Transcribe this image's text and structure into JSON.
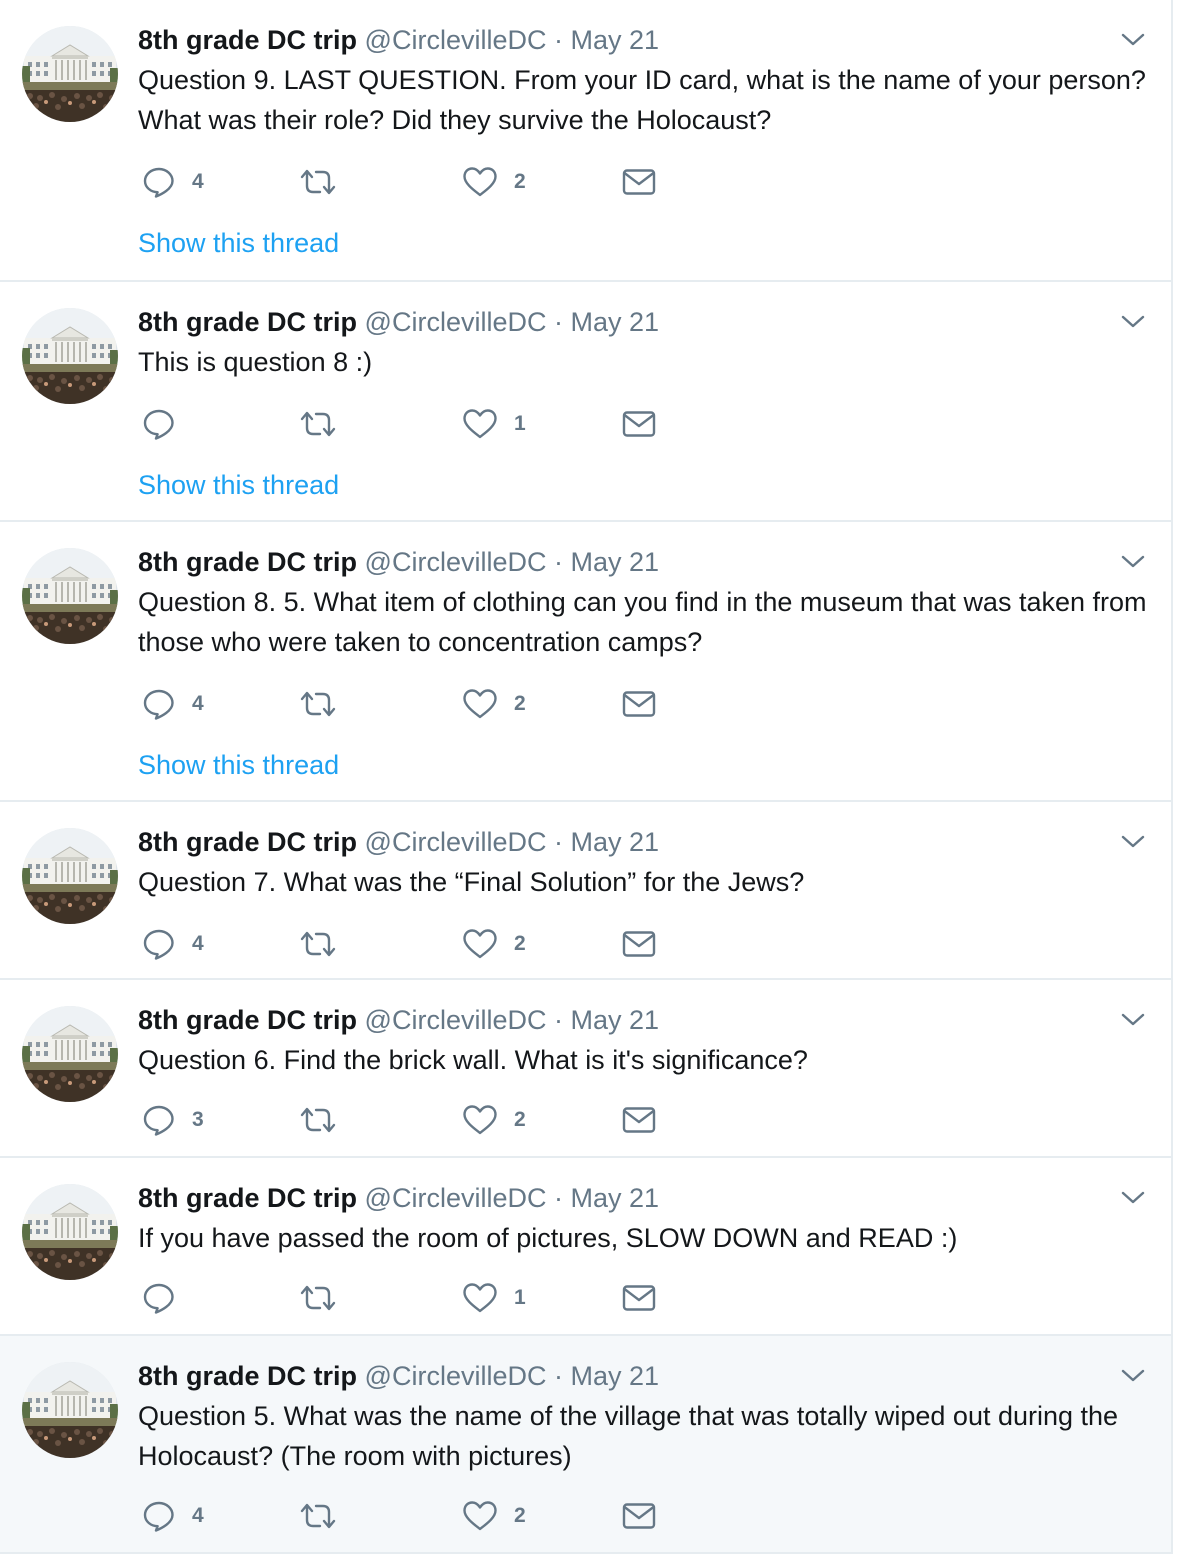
{
  "colors": {
    "link": "#1da1f2",
    "muted": "#657786",
    "text": "#14171a",
    "border": "#e6ecf0",
    "highlight": "#f5f8fa"
  },
  "icons": {
    "reply": "reply-icon",
    "retweet": "retweet-icon",
    "like": "heart-icon",
    "dm": "envelope-icon",
    "menu": "chevron-down-icon"
  },
  "tweets": [
    {
      "name": "8th grade DC trip",
      "handle": "@CirclevilleDC",
      "dot": "·",
      "date": "May 21",
      "text": "Question 9. LAST QUESTION. From your ID card, what is the name of your person? What was their role? Did they survive the Holocaust?",
      "replies": "4",
      "retweets": "",
      "likes": "2",
      "thread": "Show this thread"
    },
    {
      "name": "8th grade DC trip",
      "handle": "@CirclevilleDC",
      "dot": "·",
      "date": "May 21",
      "text": "This is question 8 :)",
      "replies": "",
      "retweets": "",
      "likes": "1",
      "thread": "Show this thread"
    },
    {
      "name": "8th grade DC trip",
      "handle": "@CirclevilleDC",
      "dot": "·",
      "date": "May 21",
      "text": "Question 8. 5. What item of clothing can you find in the museum that was taken from those who were taken to concentration camps?",
      "replies": "4",
      "retweets": "",
      "likes": "2",
      "thread": "Show this thread"
    },
    {
      "name": "8th grade DC trip",
      "handle": "@CirclevilleDC",
      "dot": "·",
      "date": "May 21",
      "text": "Question 7. What was the “Final Solution” for the Jews?",
      "replies": "4",
      "retweets": "",
      "likes": "2",
      "thread": ""
    },
    {
      "name": "8th grade DC trip",
      "handle": "@CirclevilleDC",
      "dot": "·",
      "date": "May 21",
      "text": "Question 6. Find the brick wall. What is it's significance?",
      "replies": "3",
      "retweets": "",
      "likes": "2",
      "thread": ""
    },
    {
      "name": "8th grade DC trip",
      "handle": "@CirclevilleDC",
      "dot": "·",
      "date": "May 21",
      "text": "If you have passed the room of pictures, SLOW DOWN and READ :)",
      "replies": "",
      "retweets": "",
      "likes": "1",
      "thread": ""
    },
    {
      "name": "8th grade DC trip",
      "handle": "@CirclevilleDC",
      "dot": "·",
      "date": "May 21",
      "text": "Question 5. What was the name of the village that was totally wiped out during the Holocaust? (The room with pictures)",
      "replies": "4",
      "retweets": "",
      "likes": "2",
      "thread": ""
    }
  ]
}
